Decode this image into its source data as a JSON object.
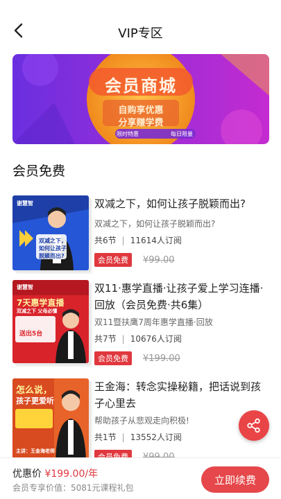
{
  "header": {
    "title": "VIP专区",
    "back_icon": "back-arrow-icon"
  },
  "banner": {
    "title": "会员商城",
    "line1": "自购享优惠",
    "line2": "分享赚学费",
    "tags": [
      "限时特惠",
      "每日限量"
    ],
    "colors": {
      "bg_left": "#6a2fe0",
      "bg_right": "#c42bd0",
      "circle": "#f8a62a"
    }
  },
  "section": {
    "title": "会员免费"
  },
  "courses": [
    {
      "title": "双减之下，如何让孩子脱颖而出?",
      "desc": "双减之下，如何让孩子脱颖而出?",
      "lessons": "共6节",
      "subs": "11614人订阅",
      "badge": "会员免费",
      "orig_price": "¥99.00",
      "thumb": {
        "brand": "谢慧智",
        "line1": "双减之下，",
        "line2": "如何让孩子",
        "line3": "脱颖而出?"
      }
    },
    {
      "title": "双11·惠学直播·让孩子爱上学习连播·回放（会员免费·共6集）",
      "desc": "双11暨扶鹰7周年惠学直播·回放",
      "lessons": "共7节",
      "subs": "10676人订阅",
      "badge": "会员免费",
      "orig_price": "¥199.00",
      "thumb": {
        "brand": "谢慧智",
        "line1": "7天惠学直播",
        "line2": "双减之下 父母必懂",
        "line3": "送出5台"
      }
    },
    {
      "title": "王金海：转念实操秘籍，把话说到孩子心里去",
      "desc": "帮助孩子从悲观走向积极!",
      "lessons": "共1节",
      "subs": "13552人订阅",
      "badge": "会员免费",
      "orig_price": "¥99.00",
      "thumb": {
        "brand": "",
        "line1": "怎么说，",
        "line2": "孩子更爱听",
        "line3": "主讲：王金海老师"
      }
    }
  ],
  "footer": {
    "price_label": "优惠价",
    "price": "¥199.00/年",
    "value_label": "会员专享价值：",
    "value": "5081元课程礼包",
    "button": "立即续费"
  },
  "colors": {
    "accent": "#e0383e"
  }
}
